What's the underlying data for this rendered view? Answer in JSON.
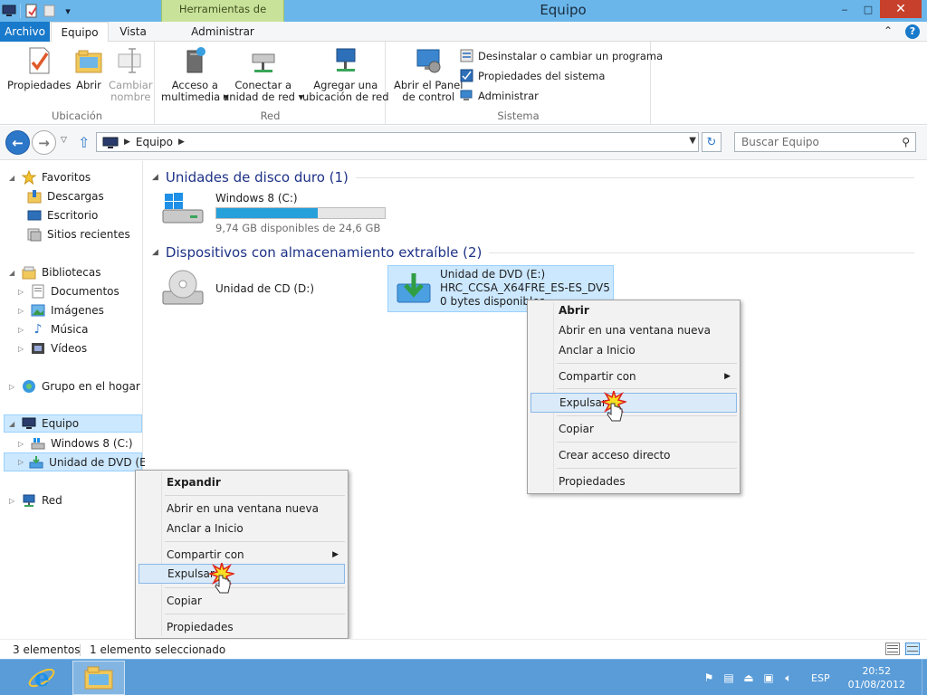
{
  "window": {
    "title": "Equipo",
    "contextual_tab_group": "Herramientas de unidad",
    "buttons": {
      "minimize": "‒",
      "maximize": "□",
      "close": "✕"
    }
  },
  "ribbon_tabs": {
    "file": "Archivo",
    "computer": "Equipo",
    "view": "Vista",
    "manage": "Administrar"
  },
  "ribbon": {
    "groups": {
      "location": {
        "label": "Ubicación",
        "properties": "Propiedades",
        "open": "Abrir",
        "rename_line1": "Cambiar",
        "rename_line2": "nombre"
      },
      "network": {
        "label": "Red",
        "media_line1": "Acceso a",
        "media_line2": "multimedia",
        "map_line1": "Conectar a",
        "map_line2": "unidad de red",
        "add_line1": "Agregar una",
        "add_line2": "ubicación de red"
      },
      "system": {
        "label": "Sistema",
        "control_line1": "Abrir el Panel",
        "control_line2": "de control",
        "uninstall": "Desinstalar o cambiar un programa",
        "sysprops": "Propiedades del sistema",
        "manage": "Administrar"
      }
    }
  },
  "address_bar": {
    "path": "Equipo"
  },
  "search": {
    "placeholder": "Buscar Equipo"
  },
  "nav_pane": {
    "favorites": "Favoritos",
    "downloads": "Descargas",
    "desktop": "Escritorio",
    "recent": "Sitios recientes",
    "libraries": "Bibliotecas",
    "documents": "Documentos",
    "pictures": "Imágenes",
    "music": "Música",
    "videos": "Vídeos",
    "homegroup": "Grupo en el hogar",
    "computer": "Equipo",
    "drive_c": "Windows 8 (C:)",
    "drive_e": "Unidad de DVD (E:) H",
    "network": "Red"
  },
  "content": {
    "hdd_section": "Unidades de disco duro (1)",
    "removable_section": "Dispositivos con almacenamiento extraíble (2)",
    "drive_c": {
      "name": "Windows 8 (C:)",
      "free_text": "9,74 GB disponibles de 24,6 GB",
      "used_fraction": 0.604
    },
    "drive_d": {
      "name": "Unidad de CD (D:)"
    },
    "drive_e": {
      "name": "Unidad de DVD (E:)",
      "label": "HRC_CCSA_X64FRE_ES-ES_DV5",
      "free_text": "0 bytes disponibles"
    }
  },
  "context_menu_content": {
    "open": "Abrir",
    "open_new_window": "Abrir en una ventana nueva",
    "pin_start": "Anclar a Inicio",
    "share_with": "Compartir con",
    "eject": "Expulsar",
    "copy": "Copiar",
    "create_shortcut": "Crear acceso directo",
    "properties": "Propiedades"
  },
  "context_menu_nav": {
    "expand": "Expandir",
    "open_new_window": "Abrir en una ventana nueva",
    "pin_start": "Anclar a Inicio",
    "share_with": "Compartir con",
    "eject": "Expulsar",
    "copy": "Copiar",
    "properties": "Propiedades"
  },
  "status_bar": {
    "count": "3 elementos",
    "selected": "1 elemento seleccionado"
  },
  "taskbar": {
    "language": "ESP",
    "time": "20:52",
    "date": "01/08/2012"
  },
  "colors": {
    "accent": "#1979ca",
    "titlebar": "#6ab6ea",
    "taskbar": "#5a9cd8",
    "selection": "#cce8ff",
    "progress": "#26a0da"
  }
}
